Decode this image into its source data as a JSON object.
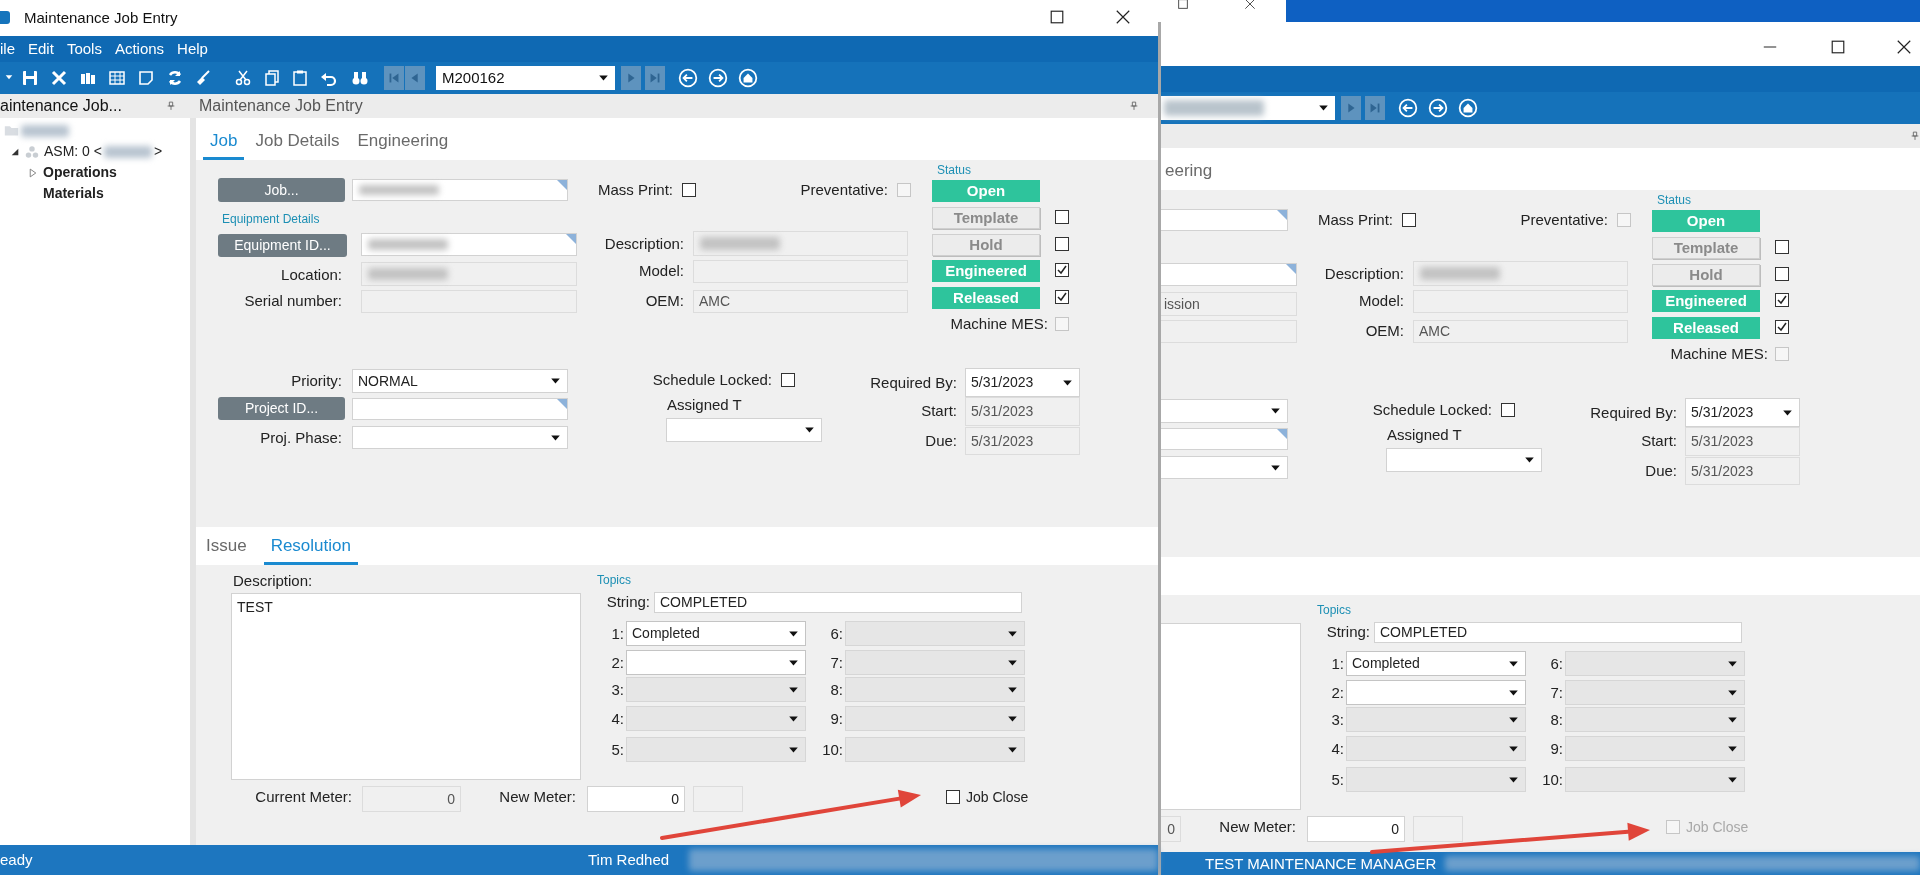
{
  "windows": [
    {
      "controls": [
        {
          "kind": "maximize"
        },
        {
          "kind": "close"
        }
      ],
      "title": "Maintenance Job Entry",
      "menu": [
        "ile",
        "Edit",
        "Tools",
        "Actions",
        "Help"
      ],
      "record": {
        "value": "M200162"
      },
      "tree_panel": {
        "title": "aintenance Job...",
        "tree": [
          {
            "kind": "root",
            "redacted": true,
            "children": [
              {
                "kind": "assembly",
                "label": "ASM: 0 <",
                "suffix": ">",
                "redacted": true,
                "expanded": true,
                "children": [
                  {
                    "kind": "node",
                    "label": "Operations",
                    "expanded": false
                  },
                  {
                    "kind": "node",
                    "label": "Materials"
                  }
                ]
              }
            ]
          }
        ]
      },
      "panel_title": "Maintenance Job Entry",
      "tabs": [
        {
          "label": "Job",
          "selected": true
        },
        {
          "label": "Job Details",
          "selected": false
        },
        {
          "label": "Engineering",
          "selected": false
        }
      ],
      "form": {
        "job": {
          "kind": "text",
          "button": "Job...",
          "redacted": true,
          "lookup": true
        },
        "mass_print": {
          "label": "Mass Print:",
          "checked": false
        },
        "preventative": {
          "label": "Preventative:",
          "checked": false,
          "disabled": true
        },
        "equipment_heading": "Equipment Details",
        "equipment": {
          "kind": "text",
          "button": "Equipment ID...",
          "redacted": true,
          "lookup": true
        },
        "location": {
          "kind": "text",
          "label": "Location:",
          "redacted": true,
          "read_only": true
        },
        "serial": {
          "kind": "text",
          "label": "Serial number:",
          "read_only": true
        },
        "description": {
          "kind": "text",
          "label": "Description:",
          "redacted": true,
          "read_only": true
        },
        "model": {
          "kind": "text",
          "label": "Model:",
          "read_only": true
        },
        "oem": {
          "kind": "text",
          "label": "OEM:",
          "value": "AMC",
          "read_only": true
        },
        "status": {
          "title": "Status",
          "buttons": [
            {
              "label": "Open",
              "on": true
            },
            {
              "label": "Template",
              "on": false,
              "checked": false
            },
            {
              "label": "Hold",
              "on": false,
              "checked": false
            },
            {
              "label": "Engineered",
              "on": true,
              "checked": true
            },
            {
              "label": "Released",
              "on": true,
              "checked": true
            }
          ]
        },
        "machine_mes": {
          "label": "Machine MES:",
          "checked": false,
          "disabled": true
        },
        "priority": {
          "kind": "combo",
          "label": "Priority:",
          "value": "NORMAL"
        },
        "project": {
          "kind": "text",
          "button": "Project ID...",
          "lookup": true
        },
        "phase": {
          "kind": "combo",
          "label": "Proj. Phase:"
        },
        "schedule_locked": {
          "label": "Schedule Locked:",
          "checked": false
        },
        "assigned": {
          "kind": "combo",
          "label": "Assigned T"
        },
        "required_by": {
          "kind": "date",
          "label": "Required By:",
          "value": "5/31/2023"
        },
        "start": {
          "kind": "text",
          "label": "Start:",
          "value": "5/31/2023",
          "read_only": true
        },
        "due": {
          "kind": "text",
          "label": "Due:",
          "value": "5/31/2023",
          "read_only": true
        }
      },
      "lower_tabs": [
        {
          "label": "Issue",
          "selected": false
        },
        {
          "label": "Resolution",
          "selected": true
        }
      ],
      "resolution": {
        "description": {
          "kind": "memo",
          "label": "Description:",
          "value": "TEST"
        },
        "topics_heading": "Topics",
        "string": {
          "kind": "text",
          "label": "String:",
          "value": "COMPLETED"
        },
        "topics": [
          {
            "label": "1:",
            "value": "Completed",
            "disabled": false
          },
          {
            "label": "2:",
            "disabled": false
          },
          {
            "label": "3:",
            "disabled": true
          },
          {
            "label": "4:",
            "disabled": true
          },
          {
            "label": "5:",
            "disabled": true
          },
          {
            "label": "6:",
            "disabled": true
          },
          {
            "label": "7:",
            "disabled": true
          },
          {
            "label": "8:",
            "disabled": true
          },
          {
            "label": "9:",
            "disabled": true
          },
          {
            "label": "10:",
            "disabled": true
          }
        ],
        "current_meter": {
          "kind": "text",
          "label": "Current Meter:",
          "value": "0",
          "read_only": true
        },
        "new_meter": {
          "kind": "text",
          "label": "New Meter:",
          "value": "0"
        },
        "meter_unit": {
          "kind": "text",
          "read_only": true
        },
        "job_close": {
          "label": "Job Close",
          "checked": false,
          "disabled": false
        }
      },
      "status_bar": [
        {
          "kind": "ready",
          "text": "eady"
        },
        {
          "kind": "user",
          "text": "Tim Redhed"
        },
        {
          "kind": "blur"
        }
      ]
    },
    {
      "controls": [
        {
          "kind": "minimize"
        },
        {
          "kind": "maximize"
        },
        {
          "kind": "close"
        }
      ],
      "record": {
        "redacted": true
      },
      "tabs": [
        {
          "label": "eering",
          "selected": false
        }
      ],
      "form": {
        "job": {
          "kind": "text",
          "lookup": true
        },
        "mass_print": {
          "label": "Mass Print:",
          "checked": false
        },
        "preventative": {
          "label": "Preventative:",
          "checked": false,
          "disabled": true
        },
        "equipment": {
          "kind": "text",
          "lookup": true
        },
        "location": {
          "kind": "text",
          "value": "ission",
          "read_only": true
        },
        "serial": {
          "kind": "text",
          "read_only": true
        },
        "description": {
          "kind": "text",
          "label": "Description:",
          "redacted": true,
          "read_only": true
        },
        "model": {
          "kind": "text",
          "label": "Model:",
          "read_only": true
        },
        "oem": {
          "kind": "text",
          "label": "OEM:",
          "value": "AMC",
          "read_only": true
        },
        "status": {
          "title": "Status",
          "buttons": [
            {
              "label": "Open",
              "on": true
            },
            {
              "label": "Template",
              "on": false,
              "checked": false
            },
            {
              "label": "Hold",
              "on": false,
              "checked": false
            },
            {
              "label": "Engineered",
              "on": true,
              "checked": true
            },
            {
              "label": "Released",
              "on": true,
              "checked": true
            }
          ]
        },
        "machine_mes": {
          "label": "Machine MES:",
          "checked": false,
          "disabled": true
        },
        "priority": {
          "kind": "combo"
        },
        "project": {
          "kind": "text",
          "lookup": true
        },
        "phase": {
          "kind": "combo"
        },
        "schedule_locked": {
          "label": "Schedule Locked:",
          "checked": false
        },
        "assigned": {
          "kind": "combo",
          "label": "Assigned T"
        },
        "required_by": {
          "kind": "date",
          "label": "Required By:",
          "value": "5/31/2023"
        },
        "start": {
          "kind": "text",
          "label": "Start:",
          "value": "5/31/2023",
          "read_only": true
        },
        "due": {
          "kind": "text",
          "label": "Due:",
          "value": "5/31/2023",
          "read_only": true
        }
      },
      "resolution": {
        "description": {
          "kind": "memo"
        },
        "topics_heading": "Topics",
        "string": {
          "kind": "text",
          "label": "String:",
          "value": "COMPLETED"
        },
        "topics": [
          {
            "label": "1:",
            "value": "Completed",
            "disabled": false
          },
          {
            "label": "2:",
            "disabled": false
          },
          {
            "label": "3:",
            "disabled": true
          },
          {
            "label": "4:",
            "disabled": true
          },
          {
            "label": "5:",
            "disabled": true
          },
          {
            "label": "6:",
            "disabled": true
          },
          {
            "label": "7:",
            "disabled": true
          },
          {
            "label": "8:",
            "disabled": true
          },
          {
            "label": "9:",
            "disabled": true
          },
          {
            "label": "10:",
            "disabled": true
          }
        ],
        "current_meter": {
          "kind": "text",
          "value": "0",
          "read_only": true
        },
        "new_meter": {
          "kind": "text",
          "label": "New Meter:",
          "value": "0"
        },
        "meter_unit": {
          "kind": "text",
          "read_only": true
        },
        "job_close": {
          "label": "Job Close",
          "checked": false,
          "disabled": true
        }
      },
      "status_bar": [
        {
          "kind": "role",
          "text": "TEST MAINTENANCE MANAGER"
        },
        {
          "kind": "blur"
        }
      ]
    }
  ]
}
